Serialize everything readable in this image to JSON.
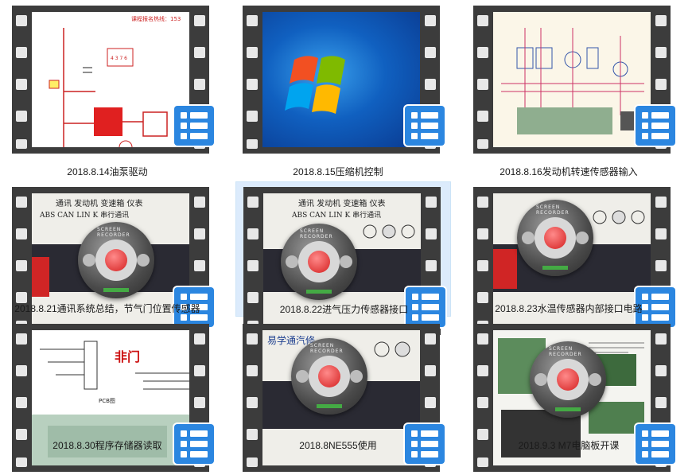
{
  "videos": [
    {
      "caption": "2018.8.14油泵驱动",
      "thumb_text": "课程报名热线：153",
      "selected": false
    },
    {
      "caption": "2018.8.15压缩机控制",
      "thumb_text": "",
      "selected": false
    },
    {
      "caption": "2018.8.16发动机转速传感器输入",
      "thumb_text": "",
      "selected": false
    },
    {
      "caption": "2018.8.21通讯系统总结，节气门位置传感器",
      "thumb_text": "通讯 发动机 变速箱 仪表",
      "thumb_text2": "ABS CAN LIN K 串行通讯",
      "selected": false
    },
    {
      "caption": "2018.8.22进气压力传感器接口",
      "thumb_text": "通讯 发动机 变速箱 仪表",
      "thumb_text2": "ABS CAN LIN K 串行通讯",
      "selected": true
    },
    {
      "caption": "2018.8.23水温传感器内部接口电路",
      "thumb_text": "",
      "selected": false
    },
    {
      "caption": "2018.8.30程序存储器读取",
      "thumb_text": "非门",
      "thumb_text2": "PCB图",
      "selected": false
    },
    {
      "caption": "2018.8NE555使用",
      "thumb_text": "易学通汽修",
      "selected": false
    },
    {
      "caption": "2018.9.3 M7电脑板开课",
      "thumb_text": "",
      "selected": false
    }
  ],
  "recorder_label": "SCREEN RECORDER",
  "colors": {
    "badge": "#2b86e0",
    "selection": "#dcebfc",
    "film": "#3c3c3c"
  },
  "icons": {
    "badge": "video-file-icon",
    "recorder": "screen-recorder-icon"
  }
}
